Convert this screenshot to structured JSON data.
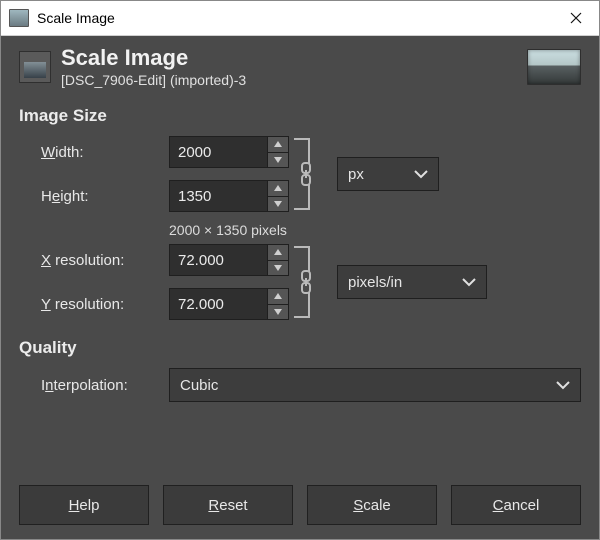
{
  "window": {
    "title": "Scale Image"
  },
  "header": {
    "title": "Scale Image",
    "subtitle": "[DSC_7906-Edit] (imported)-3"
  },
  "sections": {
    "image_size": {
      "title": "Image Size",
      "width_label_pre": "W",
      "width_label_post": "idth:",
      "height_label_pre": "H",
      "height_label_ul": "e",
      "height_label_post": "ight:",
      "width_value": "2000",
      "height_value": "1350",
      "unit": "px",
      "readout": "2000 × 1350 pixels",
      "x_res_label_ul": "X",
      "x_res_label_post": " resolution:",
      "y_res_label_ul": "Y",
      "y_res_label_post": " resolution:",
      "x_res_value": "72.000",
      "y_res_value": "72.000",
      "res_unit": "pixels/in"
    },
    "quality": {
      "title": "Quality",
      "interp_label_pre": "I",
      "interp_label_ul": "n",
      "interp_label_post": "terpolation:",
      "interp_value": "Cubic"
    }
  },
  "buttons": {
    "help_ul": "H",
    "help_post": "elp",
    "reset_ul": "R",
    "reset_post": "eset",
    "scale_ul": "S",
    "scale_post": "cale",
    "cancel_ul": "C",
    "cancel_post": "ancel"
  }
}
